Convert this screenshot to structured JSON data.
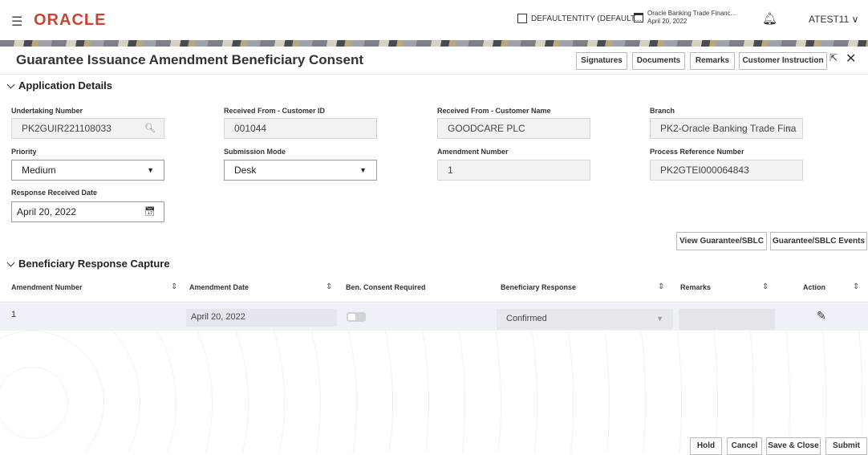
{
  "header": {
    "menu_icon": "hamburger-icon",
    "logo": "ORACLE",
    "entity": "DEFAULTENTITY (DEFAULT...",
    "bank_name": "Oracle Banking Trade Financ...",
    "bank_date": "April 20, 2022",
    "user": "ATEST11"
  },
  "page": {
    "title": "Guarantee Issuance Amendment Beneficiary Consent",
    "toolbar": [
      "Signatures",
      "Documents",
      "Remarks",
      "Customer Instruction"
    ]
  },
  "app_details": {
    "section_title": "Application Details",
    "undertaking_label": "Undertaking Number",
    "undertaking_value": "PK2GUIR221108033",
    "cust_id_label": "Received From - Customer ID",
    "cust_id_value": "001044",
    "cust_name_label": "Received From - Customer Name",
    "cust_name_value": "GOODCARE PLC",
    "branch_label": "Branch",
    "branch_value": "PK2-Oracle Banking Trade Fina",
    "priority_label": "Priority",
    "priority_value": "Medium",
    "submission_label": "Submission Mode",
    "submission_value": "Desk",
    "amend_no_label": "Amendment Number",
    "amend_no_value": "1",
    "proc_ref_label": "Process Reference Number",
    "proc_ref_value": "PK2GTEI000064843",
    "resp_date_label": "Response Received Date",
    "resp_date_value": "April 20, 2022"
  },
  "actions": {
    "view_guarantee": "View Guarantee/SBLC",
    "guarantee_events": "Guarantee/SBLC Events"
  },
  "response": {
    "section_title": "Beneficiary Response Capture",
    "columns": [
      "Amendment Number",
      "Amendment Date",
      "Ben. Consent Required",
      "Beneficiary Response",
      "Remarks",
      "Action"
    ],
    "row": {
      "amendment_number": "1",
      "amendment_date": "April 20, 2022",
      "consent_required": false,
      "beneficiary_response": "Confirmed",
      "remarks": ""
    }
  },
  "footer": {
    "hold": "Hold",
    "cancel": "Cancel",
    "save_close": "Save & Close",
    "submit": "Submit"
  }
}
